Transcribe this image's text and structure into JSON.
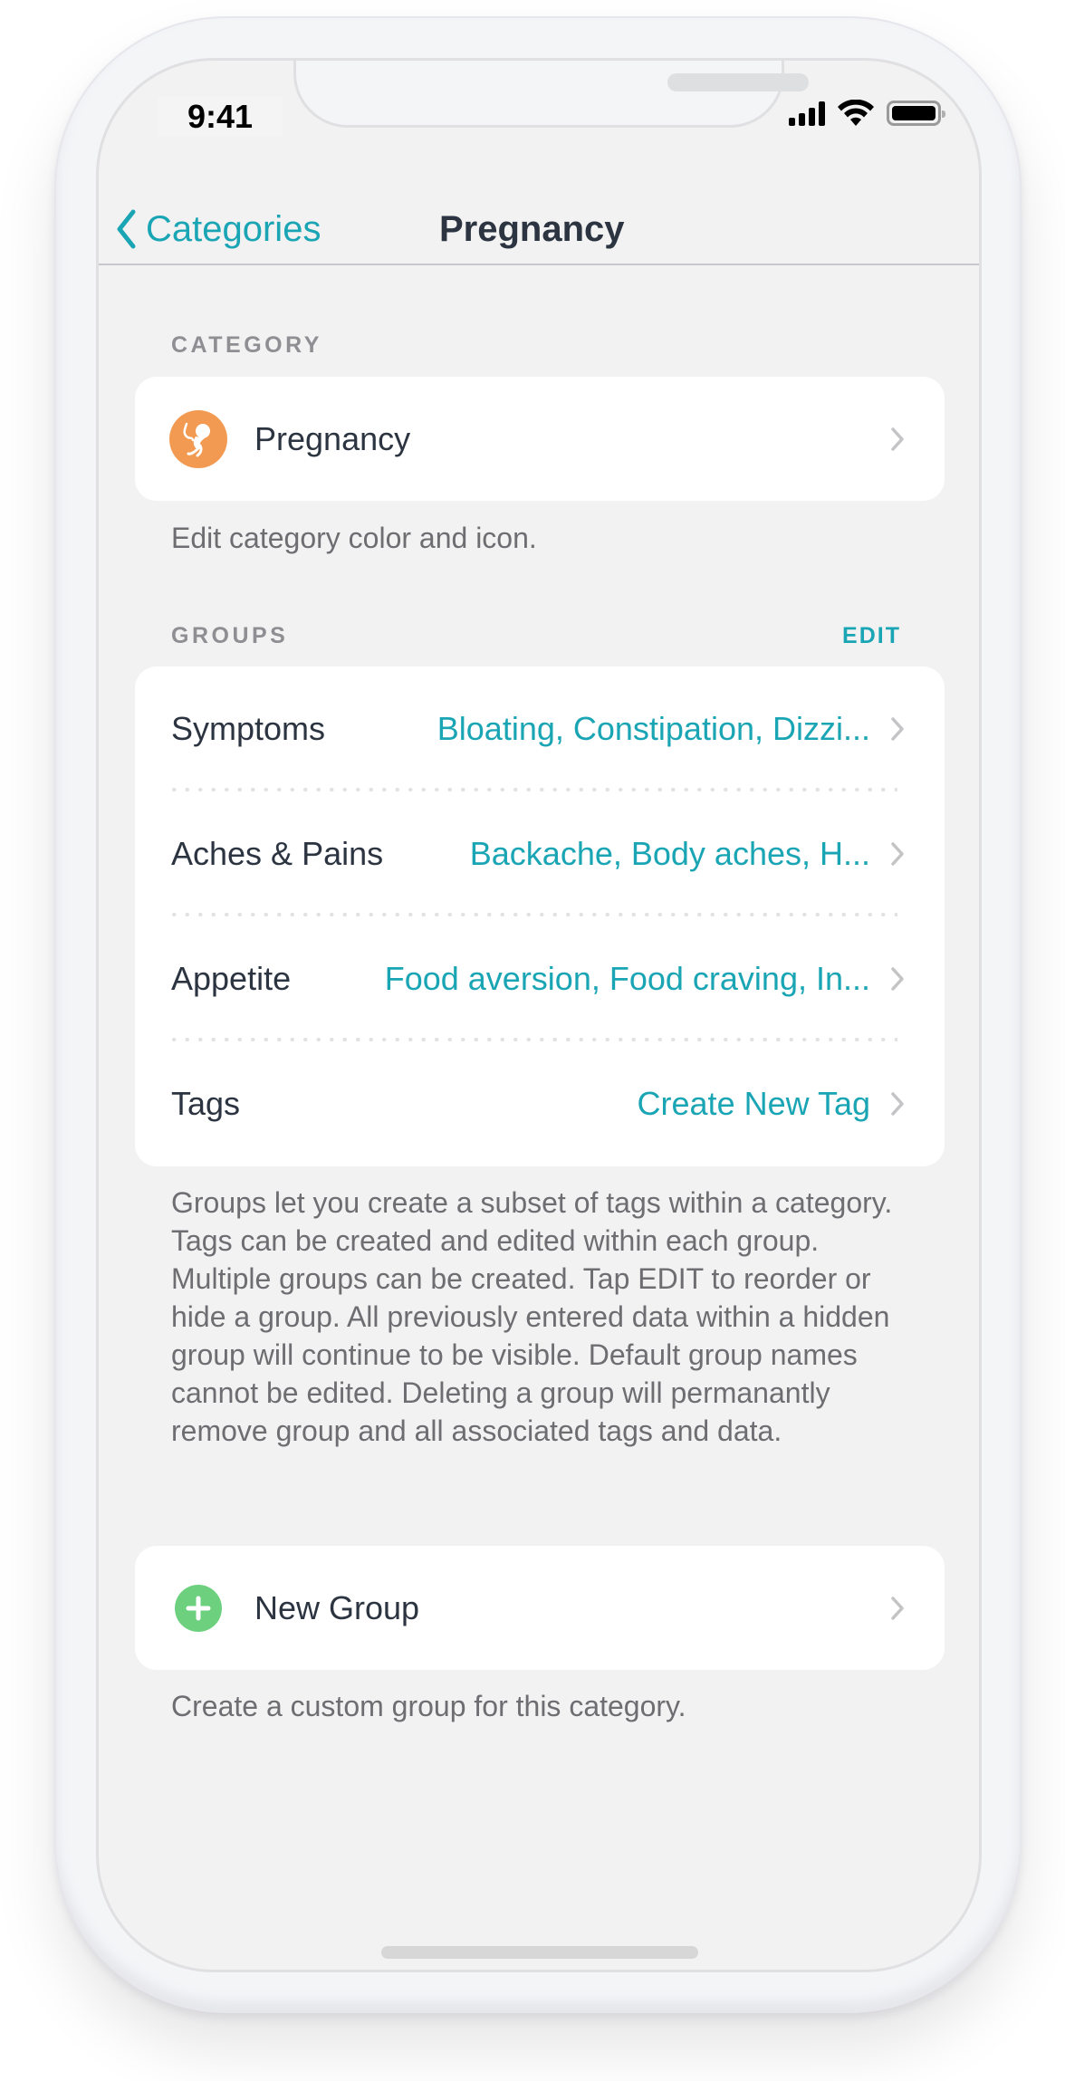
{
  "status_bar": {
    "time": "9:41",
    "icons": [
      "cellular-signal-icon",
      "wifi-icon",
      "battery-icon"
    ]
  },
  "navbar": {
    "back_label": "Categories",
    "title": "Pregnancy"
  },
  "category_section": {
    "header": "CATEGORY",
    "item": {
      "label": "Pregnancy",
      "icon": "fetus-icon",
      "icon_color": "#F39A52"
    },
    "footer": "Edit category color and icon."
  },
  "groups_section": {
    "header": "GROUPS",
    "edit_label": "EDIT",
    "rows": [
      {
        "label": "Symptoms",
        "value": "Bloating, Constipation, Dizzi..."
      },
      {
        "label": "Aches & Pains",
        "value": "Backache, Body aches, H..."
      },
      {
        "label": "Appetite",
        "value": "Food aversion, Food craving, In..."
      },
      {
        "label": "Tags",
        "value": "Create New Tag"
      }
    ],
    "footer": "Groups let you create a subset of tags within a category. Tags can be created and edited within each group. Multiple groups can be created. Tap EDIT to reorder or hide a group. All previously entered data within a hidden group will continue to be visible. Default group names cannot be edited. Deleting a group will permanantly remove group and all associated tags and data."
  },
  "new_group_section": {
    "label": "New Group",
    "icon": "plus-circle-icon",
    "icon_color": "#6DD07F",
    "footer": "Create a custom group for this category."
  },
  "colors": {
    "accent": "#1AA5B5",
    "text_primary": "#2B3440",
    "text_secondary": "#6D6D72",
    "section_header": "#8E8E93",
    "background": "#F2F2F2"
  }
}
